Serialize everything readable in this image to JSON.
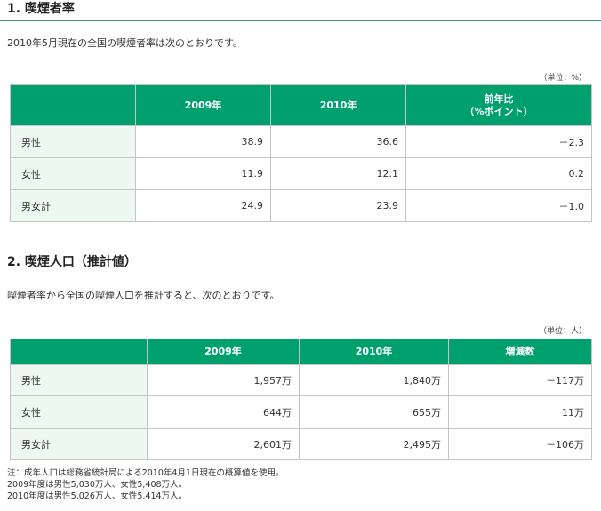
{
  "section1": {
    "heading": "1. 喫煙者率",
    "lead": "2010年5月現在の全国の喫煙者率は次のとおりです。",
    "unit": "（単位：%）",
    "columns": [
      "2009年",
      "2010年",
      "前年比",
      "（%ポイント）"
    ],
    "rows": [
      {
        "label": "男性",
        "v2009": "38.9",
        "v2010": "36.6",
        "diff": "－2.3"
      },
      {
        "label": "女性",
        "v2009": "11.9",
        "v2010": "12.1",
        "diff": "0.2"
      },
      {
        "label": "男女計",
        "v2009": "24.9",
        "v2010": "23.9",
        "diff": "－1.0"
      }
    ]
  },
  "section2": {
    "heading": "2. 喫煙人口（推計値）",
    "lead": "喫煙者率から全国の喫煙人口を推計すると、次のとおりです。",
    "unit": "（単位：人）",
    "columns": [
      "2009年",
      "2010年",
      "増減数"
    ],
    "rows": [
      {
        "label": "男性",
        "v2009": "1,957万",
        "v2010": "1,840万",
        "diff": "－117万"
      },
      {
        "label": "女性",
        "v2009": "644万",
        "v2010": "655万",
        "diff": "11万"
      },
      {
        "label": "男女計",
        "v2009": "2,601万",
        "v2010": "2,495万",
        "diff": "－106万"
      }
    ]
  },
  "notes": [
    "注：成年人口は総務省統計局による2010年4月1日現在の概算値を使用。",
    "2009年度は男性5,030万人、女性5,408万人。",
    "2010年度は男性5,026万人、女性5,414万人。"
  ]
}
